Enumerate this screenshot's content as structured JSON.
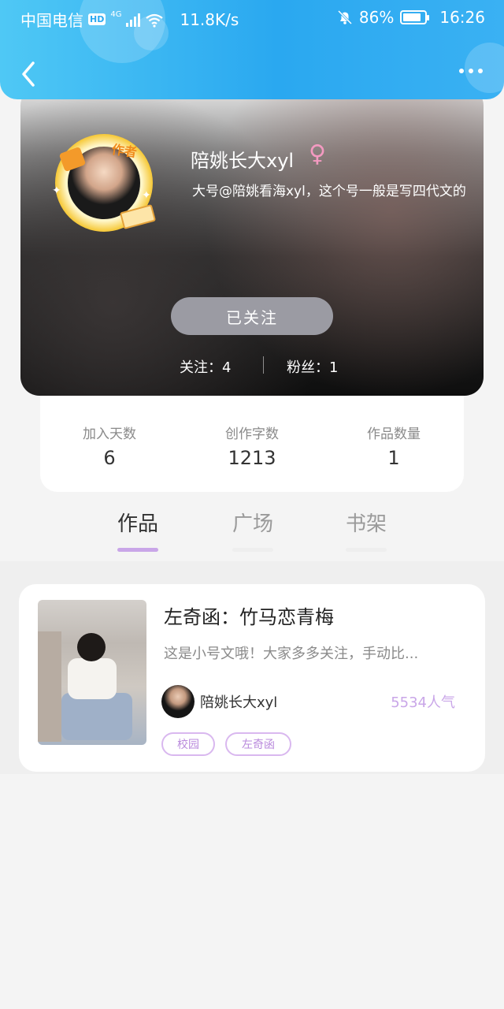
{
  "status_bar": {
    "carrier": "中国电信",
    "hd_badge": "HD",
    "network": "4G",
    "speed": "11.8K/s",
    "battery_percent": "86%",
    "battery_level": 0.86,
    "time": "16:26"
  },
  "header": {
    "back_icon": "chevron-left-icon",
    "more_icon": "more-horizontal-icon",
    "accent_color": "#2aa8f0"
  },
  "profile": {
    "author_badge": "作者",
    "name": "陪姚长大xyl",
    "gender_symbol": "♀",
    "bio": "大号@陪姚看海xyl，这个号一般是写四代文的",
    "follow_button": "已关注",
    "following_label": "关注：4",
    "fans_label": "粉丝：1"
  },
  "stats": [
    {
      "label": "加入天数",
      "value": "6"
    },
    {
      "label": "创作字数",
      "value": "1213"
    },
    {
      "label": "作品数量",
      "value": "1"
    }
  ],
  "tabs": [
    {
      "label": "作品",
      "active": true
    },
    {
      "label": "广场",
      "active": false
    },
    {
      "label": "书架",
      "active": false
    }
  ],
  "works": [
    {
      "title": "左奇函：竹马恋青梅",
      "description": "这是小号文哦！大家多多关注，手动比...",
      "author": "陪姚长大xyl",
      "popularity": "5534人气",
      "tags": [
        "校园",
        "左奇函"
      ]
    }
  ],
  "colors": {
    "tab_underline_active": "#c9a6e8",
    "tag_border": "#d9b8ef",
    "popularity": "#c9a6e8"
  }
}
